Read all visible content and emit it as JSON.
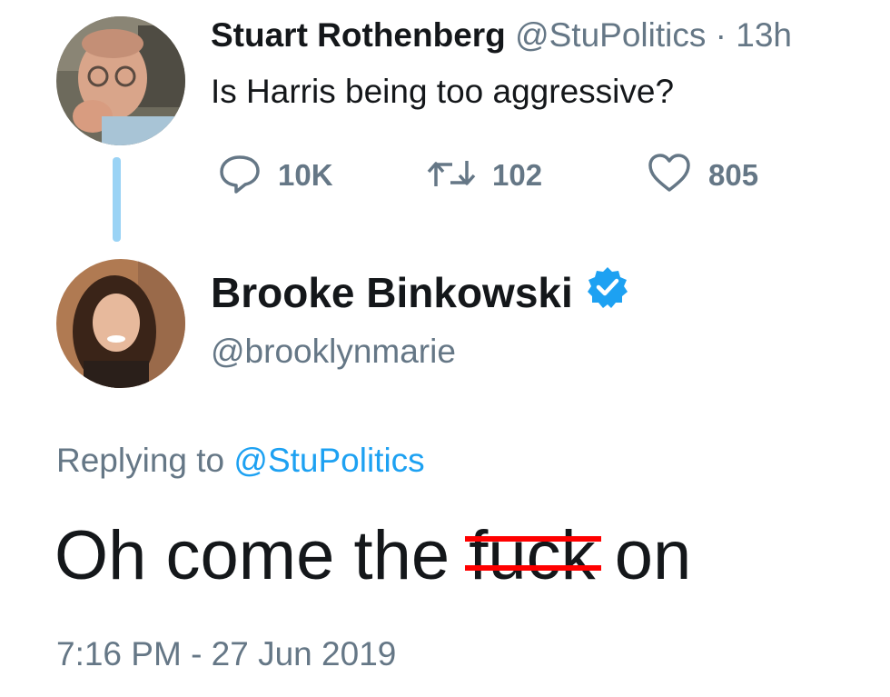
{
  "parent_tweet": {
    "author_name": "Stuart Rothenberg",
    "handle": "@StuPolitics",
    "separator": "·",
    "time": "13h",
    "text": "Is Harris being too aggressive?",
    "actions": {
      "reply_icon": "reply-icon",
      "reply_count": "10K",
      "retweet_icon": "retweet-icon",
      "retweet_count": "102",
      "like_icon": "heart-icon",
      "like_count": "805"
    }
  },
  "reply_tweet": {
    "author_name": "Brooke Binkowski",
    "verified_icon": "verified-badge-icon",
    "handle": "@brooklynmarie",
    "replying_prefix": "Replying to",
    "replying_mention": "@StuPolitics",
    "text_before": "Oh come the",
    "text_censored": "fuck",
    "text_after": "on",
    "timestamp": "7:16 PM - 27 Jun 2019"
  },
  "colors": {
    "text": "#14171a",
    "secondary": "#657786",
    "link": "#1da1f2",
    "thread_line": "#9ad3f5",
    "censor": "#ff0000"
  }
}
